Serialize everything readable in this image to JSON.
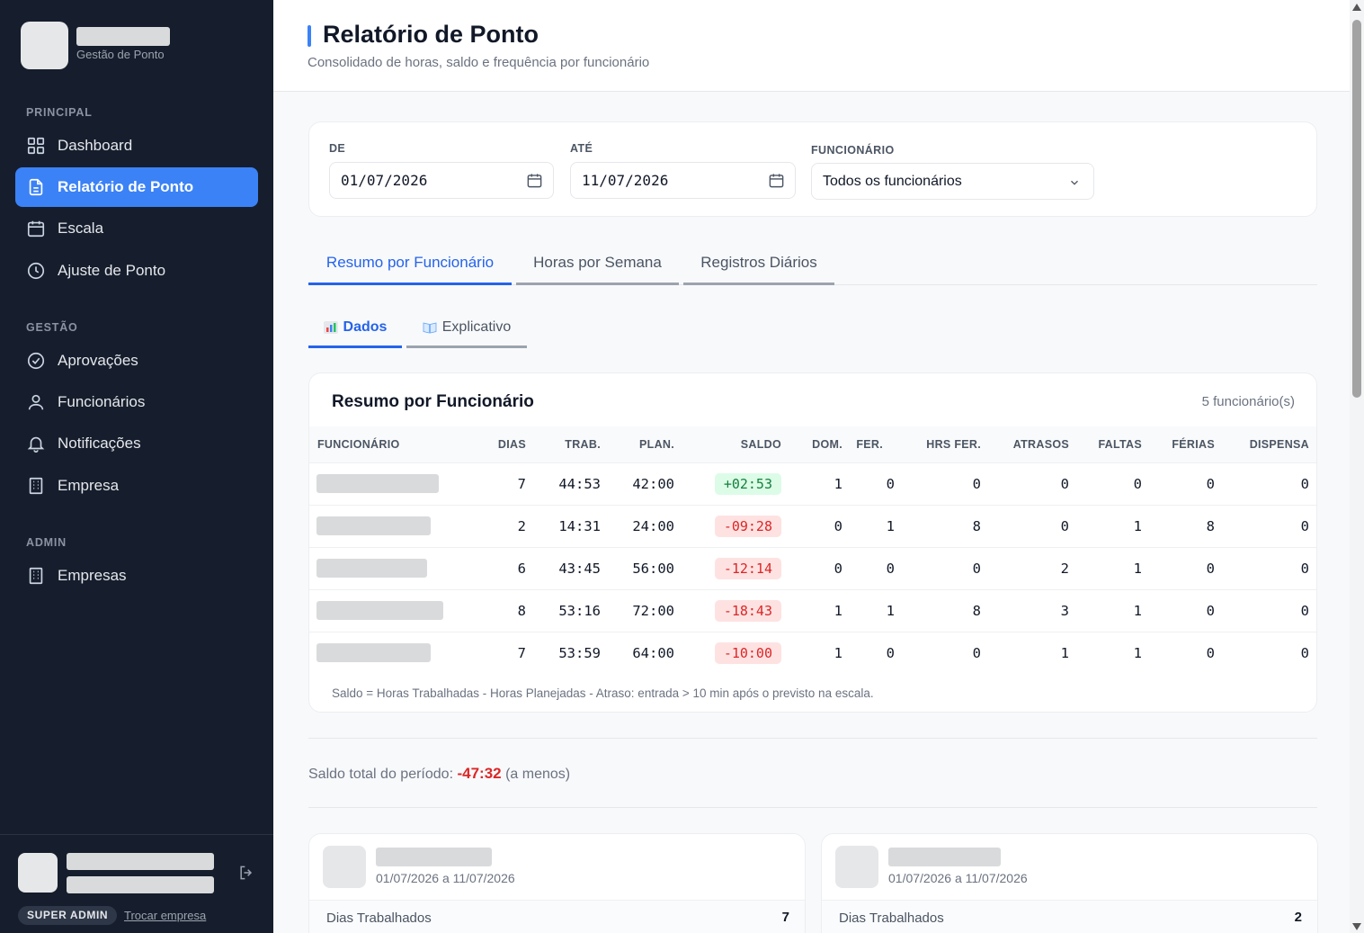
{
  "brand": {
    "subtitle": "Gestão de Ponto"
  },
  "nav": {
    "principal_label": "PRINCIPAL",
    "gestao_label": "GESTÃO",
    "admin_label": "ADMIN",
    "items": [
      {
        "label": "Dashboard",
        "icon": "grid-icon"
      },
      {
        "label": "Relatório de Ponto",
        "icon": "document-icon",
        "active": true
      },
      {
        "label": "Escala",
        "icon": "calendar-icon"
      },
      {
        "label": "Ajuste de Ponto",
        "icon": "clock-icon"
      },
      {
        "label": "Aprovações",
        "icon": "check-circle-icon"
      },
      {
        "label": "Funcionários",
        "icon": "user-icon"
      },
      {
        "label": "Notificações",
        "icon": "bell-icon"
      },
      {
        "label": "Empresa",
        "icon": "building-icon"
      },
      {
        "label": "Empresas",
        "icon": "building-icon"
      }
    ]
  },
  "footer": {
    "role": "SUPER ADMIN",
    "switch_label": "Trocar empresa"
  },
  "header": {
    "title": "Relatório de Ponto",
    "subtitle": "Consolidado de horas, saldo e frequência por funcionário"
  },
  "filters": {
    "from_label": "DE",
    "from_value": "01/07/2026",
    "to_label": "ATÉ",
    "to_value": "11/07/2026",
    "employee_label": "FUNCIONÁRIO",
    "employee_value": "Todos os funcionários"
  },
  "tabs": [
    "Resumo por Funcionário",
    "Horas por Semana",
    "Registros Diários"
  ],
  "subtabs": [
    "Dados",
    "Explicativo"
  ],
  "table": {
    "title": "Resumo por Funcionário",
    "count": "5 funcionário(s)",
    "headers": [
      "FUNCIONÁRIO",
      "DIAS",
      "TRAB.",
      "PLAN.",
      "SALDO",
      "DOM.",
      "FER.",
      "HRS FER.",
      "ATRASOS",
      "FALTAS",
      "FÉRIAS",
      "DISPENSA"
    ],
    "rows": [
      {
        "dias": "7",
        "trab": "44:53",
        "plan": "42:00",
        "saldo": "+02:53",
        "dom": "1",
        "fer": "0",
        "hrs_fer": "0",
        "atrasos": "0",
        "faltas": "0",
        "ferias": "0",
        "dispensa": "0"
      },
      {
        "dias": "2",
        "trab": "14:31",
        "plan": "24:00",
        "saldo": "-09:28",
        "dom": "0",
        "fer": "1",
        "hrs_fer": "8",
        "atrasos": "0",
        "faltas": "1",
        "ferias": "8",
        "dispensa": "0"
      },
      {
        "dias": "6",
        "trab": "43:45",
        "plan": "56:00",
        "saldo": "-12:14",
        "dom": "0",
        "fer": "0",
        "hrs_fer": "0",
        "atrasos": "2",
        "faltas": "1",
        "ferias": "0",
        "dispensa": "0"
      },
      {
        "dias": "8",
        "trab": "53:16",
        "plan": "72:00",
        "saldo": "-18:43",
        "dom": "1",
        "fer": "1",
        "hrs_fer": "8",
        "atrasos": "3",
        "faltas": "1",
        "ferias": "0",
        "dispensa": "0"
      },
      {
        "dias": "7",
        "trab": "53:59",
        "plan": "64:00",
        "saldo": "-10:00",
        "dom": "1",
        "fer": "0",
        "hrs_fer": "0",
        "atrasos": "1",
        "faltas": "1",
        "ferias": "0",
        "dispensa": "0"
      }
    ],
    "footnote": "Saldo = Horas Trabalhadas - Horas Planejadas - Atraso: entrada > 10 min após o previsto na escala."
  },
  "total": {
    "label": "Saldo total do período:",
    "value": "-47:32",
    "suffix": "(a menos)"
  },
  "cards": [
    {
      "period": "01/07/2026 a 11/07/2026",
      "row_label": "Dias Trabalhados",
      "row_value": "7"
    },
    {
      "period": "01/07/2026 a 11/07/2026",
      "row_label": "Dias Trabalhados",
      "row_value": "2"
    }
  ],
  "colors": {
    "accent": "#3b82f6",
    "sidebar_bg": "#161e2d",
    "positive": "#15803d",
    "negative": "#dc2626"
  }
}
